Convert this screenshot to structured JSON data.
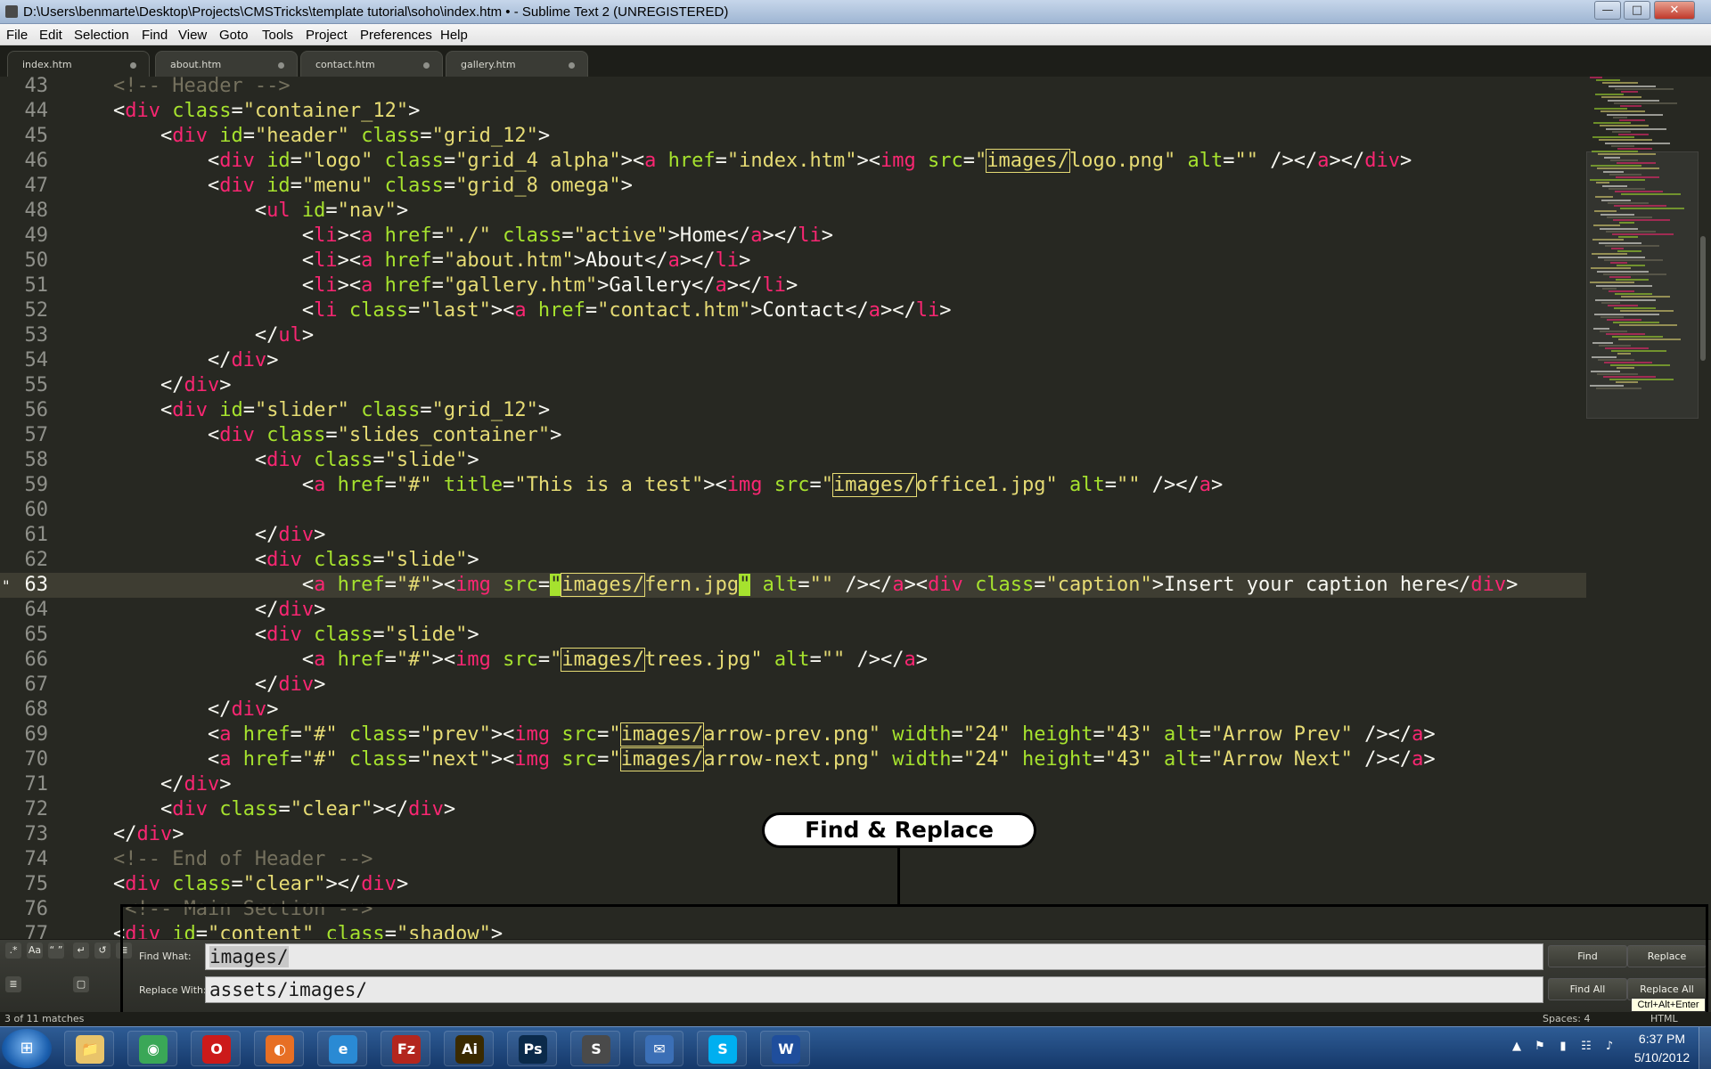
{
  "window": {
    "title": "D:\\Users\\benmarte\\Desktop\\Projects\\CMSTricks\\template tutorial\\soho\\index.htm • - Sublime Text 2 (UNREGISTERED)",
    "minimize": "—",
    "maximize": "□",
    "close": "✕"
  },
  "menu": [
    "File",
    "Edit",
    "Selection",
    "Find",
    "View",
    "Goto",
    "Tools",
    "Project",
    "Preferences",
    "Help"
  ],
  "tabs": [
    {
      "label": "index.htm",
      "active": true,
      "modified": true
    },
    {
      "label": "about.htm",
      "active": false,
      "modified": true
    },
    {
      "label": "contact.htm",
      "active": false,
      "modified": true
    },
    {
      "label": "gallery.htm",
      "active": false,
      "modified": true
    }
  ],
  "editor": {
    "current_line": 63,
    "gutter_marker": "\"",
    "lines": [
      {
        "n": "43",
        "html": "    <span class=\"c\">&lt;!-- Header --&gt;</span>"
      },
      {
        "n": "44",
        "html": "    <span class=\"w\">&lt;</span><span class=\"t\">div</span> <span class=\"a\">class</span>=<span class=\"s\">\"container_12\"</span>&gt;"
      },
      {
        "n": "45",
        "html": "        &lt;<span class=\"t\">div</span> <span class=\"a\">id</span>=<span class=\"s\">\"header\"</span> <span class=\"a\">class</span>=<span class=\"s\">\"grid_12\"</span>&gt;"
      },
      {
        "n": "46",
        "html": "            &lt;<span class=\"t\">div</span> <span class=\"a\">id</span>=<span class=\"s\">\"logo\"</span> <span class=\"a\">class</span>=<span class=\"s\">\"grid_4 alpha\"</span>&gt;&lt;<span class=\"t\">a</span> <span class=\"a\">href</span>=<span class=\"s\">\"index.htm\"</span>&gt;&lt;<span class=\"t\">img</span> <span class=\"a\">src</span>=<span class=\"s\">\"<span class=\"m\">images/</span>logo.png\"</span> <span class=\"a\">alt</span>=<span class=\"s\">\"\"</span> /&gt;&lt;/<span class=\"t\">a</span>&gt;&lt;/<span class=\"t\">div</span>&gt;"
      },
      {
        "n": "47",
        "html": "            &lt;<span class=\"t\">div</span> <span class=\"a\">id</span>=<span class=\"s\">\"menu\"</span> <span class=\"a\">class</span>=<span class=\"s\">\"grid_8 omega\"</span>&gt;"
      },
      {
        "n": "48",
        "html": "                &lt;<span class=\"t\">ul</span> <span class=\"a\">id</span>=<span class=\"s\">\"nav\"</span>&gt;"
      },
      {
        "n": "49",
        "html": "                    &lt;<span class=\"t\">li</span>&gt;&lt;<span class=\"t\">a</span> <span class=\"a\">href</span>=<span class=\"s\">\"./\"</span> <span class=\"a\">class</span>=<span class=\"s\">\"active\"</span>&gt;Home&lt;/<span class=\"t\">a</span>&gt;&lt;/<span class=\"t\">li</span>&gt;"
      },
      {
        "n": "50",
        "html": "                    &lt;<span class=\"t\">li</span>&gt;&lt;<span class=\"t\">a</span> <span class=\"a\">href</span>=<span class=\"s\">\"about.htm\"</span>&gt;About&lt;/<span class=\"t\">a</span>&gt;&lt;/<span class=\"t\">li</span>&gt;"
      },
      {
        "n": "51",
        "html": "                    &lt;<span class=\"t\">li</span>&gt;&lt;<span class=\"t\">a</span> <span class=\"a\">href</span>=<span class=\"s\">\"gallery.htm\"</span>&gt;Gallery&lt;/<span class=\"t\">a</span>&gt;&lt;/<span class=\"t\">li</span>&gt;"
      },
      {
        "n": "52",
        "html": "                    &lt;<span class=\"t\">li</span> <span class=\"a\">class</span>=<span class=\"s\">\"last\"</span>&gt;&lt;<span class=\"t\">a</span> <span class=\"a\">href</span>=<span class=\"s\">\"contact.htm\"</span>&gt;Contact&lt;/<span class=\"t\">a</span>&gt;&lt;/<span class=\"t\">li</span>&gt;"
      },
      {
        "n": "53",
        "html": "                &lt;/<span class=\"t\">ul</span>&gt;"
      },
      {
        "n": "54",
        "html": "            &lt;/<span class=\"t\">div</span>&gt;"
      },
      {
        "n": "55",
        "html": "        &lt;/<span class=\"t\">div</span>&gt;"
      },
      {
        "n": "56",
        "html": "        &lt;<span class=\"t\">div</span> <span class=\"a\">id</span>=<span class=\"s\">\"slider\"</span> <span class=\"a\">class</span>=<span class=\"s\">\"grid_12\"</span>&gt;"
      },
      {
        "n": "57",
        "html": "            &lt;<span class=\"t\">div</span> <span class=\"a\">class</span>=<span class=\"s\">\"slides_container\"</span>&gt;"
      },
      {
        "n": "58",
        "html": "                &lt;<span class=\"t\">div</span> <span class=\"a\">class</span>=<span class=\"s\">\"slide\"</span>&gt;"
      },
      {
        "n": "59",
        "html": "                    &lt;<span class=\"t\">a</span> <span class=\"a\">href</span>=<span class=\"s\">\"#\"</span> <span class=\"a\">title</span>=<span class=\"s\">\"This is a test\"</span>&gt;&lt;<span class=\"t\">img</span> <span class=\"a\">src</span>=<span class=\"s\">\"<span class=\"m\">images/</span>office1.jpg\"</span> <span class=\"a\">alt</span>=<span class=\"s\">\"\"</span> /&gt;&lt;/<span class=\"t\">a</span>&gt;"
      },
      {
        "n": "60",
        "html": ""
      },
      {
        "n": "61",
        "html": "                &lt;/<span class=\"t\">div</span>&gt;"
      },
      {
        "n": "62",
        "html": "                &lt;<span class=\"t\">div</span> <span class=\"a\">class</span>=<span class=\"s\">\"slide\"</span>&gt;"
      },
      {
        "n": "63",
        "html": "                    &lt;<span class=\"t\">a</span> <span class=\"a\">href</span>=<span class=\"s\">\"#\"</span>&gt;&lt;<span class=\"t\">img</span> <span class=\"a\">src</span>=<span class=\"s\"><span class=\"sel-br\">\"</span><span class=\"m\">images/</span>fern.jpg<span class=\"sel-br\">\"</span></span> <span class=\"a\">alt</span>=<span class=\"s\">\"\"</span> /&gt;&lt;/<span class=\"t\">a</span>&gt;&lt;<span class=\"t\">div</span> <span class=\"a\">class</span>=<span class=\"s\">\"caption\"</span>&gt;Insert your caption here&lt;/<span class=\"t\">div</span>&gt;"
      },
      {
        "n": "64",
        "html": "                &lt;/<span class=\"t\">div</span>&gt;"
      },
      {
        "n": "65",
        "html": "                &lt;<span class=\"t\">div</span> <span class=\"a\">class</span>=<span class=\"s\">\"slide\"</span>&gt;"
      },
      {
        "n": "66",
        "html": "                    &lt;<span class=\"t\">a</span> <span class=\"a\">href</span>=<span class=\"s\">\"#\"</span>&gt;&lt;<span class=\"t\">img</span> <span class=\"a\">src</span>=<span class=\"s\">\"<span class=\"m\">images/</span>trees.jpg\"</span> <span class=\"a\">alt</span>=<span class=\"s\">\"\"</span> /&gt;&lt;/<span class=\"t\">a</span>&gt;"
      },
      {
        "n": "67",
        "html": "                &lt;/<span class=\"t\">div</span>&gt;"
      },
      {
        "n": "68",
        "html": "            &lt;/<span class=\"t\">div</span>&gt;"
      },
      {
        "n": "69",
        "html": "            &lt;<span class=\"t\">a</span> <span class=\"a\">href</span>=<span class=\"s\">\"#\"</span> <span class=\"a\">class</span>=<span class=\"s\">\"prev\"</span>&gt;&lt;<span class=\"t\">img</span> <span class=\"a\">src</span>=<span class=\"s\">\"<span class=\"m\">images/</span>arrow-prev.png\"</span> <span class=\"a\">width</span>=<span class=\"s\">\"24\"</span> <span class=\"a\">height</span>=<span class=\"s\">\"43\"</span> <span class=\"a\">alt</span>=<span class=\"s\">\"Arrow Prev\"</span> /&gt;&lt;/<span class=\"t\">a</span>&gt;"
      },
      {
        "n": "70",
        "html": "            &lt;<span class=\"t\">a</span> <span class=\"a\">href</span>=<span class=\"s\">\"#\"</span> <span class=\"a\">class</span>=<span class=\"s\">\"next\"</span>&gt;&lt;<span class=\"t\">img</span> <span class=\"a\">src</span>=<span class=\"s\">\"<span class=\"m\">images/</span>arrow-next.png\"</span> <span class=\"a\">width</span>=<span class=\"s\">\"24\"</span> <span class=\"a\">height</span>=<span class=\"s\">\"43\"</span> <span class=\"a\">alt</span>=<span class=\"s\">\"Arrow Next\"</span> /&gt;&lt;/<span class=\"t\">a</span>&gt;"
      },
      {
        "n": "71",
        "html": "        &lt;/<span class=\"t\">div</span>&gt;"
      },
      {
        "n": "72",
        "html": "        &lt;<span class=\"t\">div</span> <span class=\"a\">class</span>=<span class=\"s\">\"clear\"</span>&gt;&lt;/<span class=\"t\">div</span>&gt;"
      },
      {
        "n": "73",
        "html": "    &lt;/<span class=\"t\">div</span>&gt;"
      },
      {
        "n": "74",
        "html": "    <span class=\"c\">&lt;!-- End of Header --&gt;</span>"
      },
      {
        "n": "75",
        "html": "    &lt;<span class=\"t\">div</span> <span class=\"a\">class</span>=<span class=\"s\">\"clear\"</span>&gt;&lt;/<span class=\"t\">div</span>&gt;"
      },
      {
        "n": "76",
        "html": "     <span class=\"c\">&lt;!-- Main Section --&gt;</span>"
      },
      {
        "n": "77",
        "html": "    &lt;<span class=\"t\">div</span> <span class=\"a\">id</span>=<span class=\"s\">\"content\"</span> <span class=\"a\">class</span>=<span class=\"s\">\"shadow\"</span>&gt;"
      }
    ]
  },
  "callout": {
    "label": "Find & Replace"
  },
  "find_panel": {
    "options": [
      ".*",
      "Aa",
      "“ ”",
      "↵",
      "↺",
      "≣",
      "▢"
    ],
    "find_label": "Find What:",
    "find_value": "images/",
    "replace_label": "Replace With:",
    "replace_value": "assets/images/",
    "find_button": "Find",
    "replace_button": "Replace",
    "find_all_button": "Find All",
    "replace_all_button": "Replace All",
    "tooltip": "Ctrl+Alt+Enter"
  },
  "status": {
    "matches": "3 of 11 matches",
    "spaces": "Spaces: 4",
    "syntax": "HTML"
  },
  "taskbar": {
    "start_icon": "⊞",
    "apps": [
      {
        "name": "explorer",
        "glyph": "📁",
        "color": "#e9c46a"
      },
      {
        "name": "chrome",
        "glyph": "◉",
        "color": "#3aa757"
      },
      {
        "name": "opera",
        "glyph": "O",
        "color": "#cc1a1a"
      },
      {
        "name": "firefox",
        "glyph": "◐",
        "color": "#e76f24"
      },
      {
        "name": "internet-explorer",
        "glyph": "e",
        "color": "#2a8ad4"
      },
      {
        "name": "filezilla",
        "glyph": "Fz",
        "color": "#b3261e"
      },
      {
        "name": "illustrator",
        "glyph": "Ai",
        "color": "#3a2a00"
      },
      {
        "name": "photoshop",
        "glyph": "Ps",
        "color": "#0b2a4a"
      },
      {
        "name": "sublime-text",
        "glyph": "S",
        "color": "#4a4a4a"
      },
      {
        "name": "thunderbird",
        "glyph": "✉",
        "color": "#3b6fb6"
      },
      {
        "name": "skype",
        "glyph": "S",
        "color": "#00aff0"
      },
      {
        "name": "word",
        "glyph": "W",
        "color": "#1f4e9c"
      }
    ],
    "tray_icons": [
      "▲",
      "⚑",
      "▮",
      "☷",
      "♪"
    ],
    "clock_time": "6:37 PM",
    "clock_date": "5/10/2012"
  }
}
